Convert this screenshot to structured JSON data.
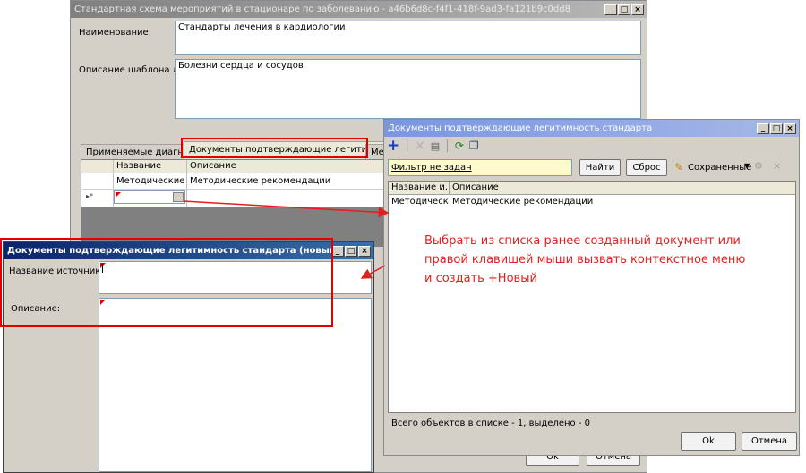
{
  "main_window": {
    "title": "Стандартная схема мероприятий в стационаре по заболеванию - a46b6d8c-f4f1-418f-9ad3-fa121b9c0dd8",
    "name_label": "Наименование:",
    "name_value": "Стандарты лечения в кардиологии",
    "desc_label": "Описание шаблона лечения:",
    "desc_value": "Болезни сердца и сосудов",
    "tabs": [
      "Применяемые диагнозы",
      "Документы подтверждающие легитимность",
      "Мер"
    ],
    "grid": {
      "columns": [
        "Название",
        "Описание"
      ],
      "rows": [
        {
          "name": "Методические р...",
          "desc": "Методические рекомендации"
        }
      ],
      "new_row_marker": "▸*"
    },
    "ok": "Ok",
    "cancel": "Отмена"
  },
  "picker_window": {
    "title": "Документы подтверждающие легитимность стандарта",
    "filter_text": "Фильтр не задан",
    "find": "Найти",
    "reset": "Сброс",
    "saved": "Сохраненные",
    "columns": [
      "Название и...",
      "Описание"
    ],
    "rows": [
      {
        "name": "Методическ...",
        "desc": "Методические рекомендации"
      }
    ],
    "status": "Всего объектов в списке - 1, выделено - 0",
    "ok": "Ok",
    "cancel": "Отмена"
  },
  "new_window": {
    "title": "Документы подтверждающие легитимность стандарта (новый)",
    "source_label": "Название источника:",
    "desc_label": "Описание:"
  },
  "annotation": {
    "lines": [
      "Выбрать из списка ранее созданный документ или",
      "правой клавишей мыши вызвать контекстное меню",
      "и создать +Новый"
    ],
    "color": "#e02020"
  }
}
